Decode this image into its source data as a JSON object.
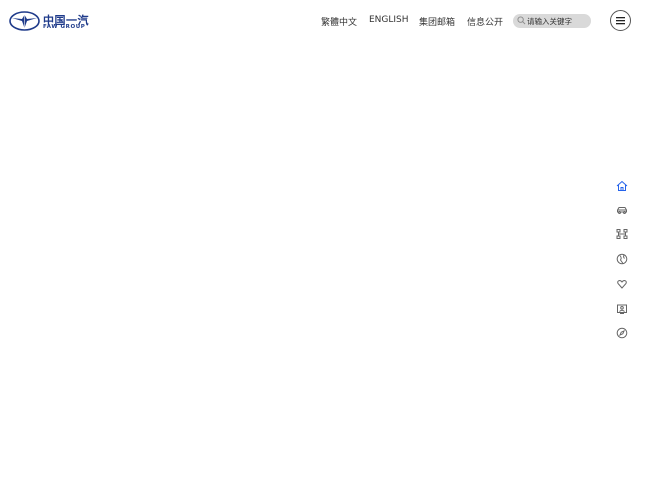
{
  "brand": {
    "name_cn": "中国一汽",
    "name_en": "FAW GROUP",
    "color": "#1e3a8a"
  },
  "nav": {
    "items": [
      {
        "label": "繁體中文"
      },
      {
        "label": "ENGLISH"
      },
      {
        "label": "集团邮箱"
      },
      {
        "label": "信息公开"
      }
    ]
  },
  "search": {
    "placeholder": "请输入关键字",
    "icon": "search-icon"
  },
  "menu": {
    "icon": "hamburger-menu-icon"
  },
  "side_nav": {
    "items": [
      {
        "icon": "home-icon",
        "active": true
      },
      {
        "icon": "car-icon"
      },
      {
        "icon": "network-icon"
      },
      {
        "icon": "globe-icon"
      },
      {
        "icon": "heart-hand-icon"
      },
      {
        "icon": "contact-card-icon"
      },
      {
        "icon": "compass-icon"
      }
    ],
    "active_color": "#2563eb",
    "color": "#666666"
  }
}
